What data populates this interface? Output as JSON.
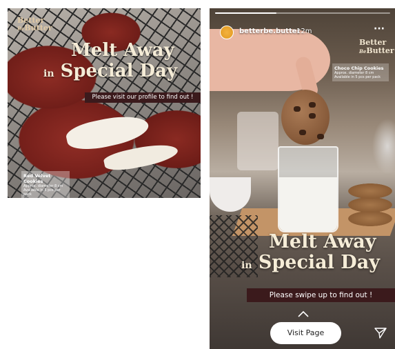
{
  "post": {
    "logo_line1": "Better",
    "logo_be": "Be",
    "logo_line2": "Butter",
    "headline_line1": "Melt Away",
    "headline_in": "in",
    "headline_line2": "Special Day",
    "banner": "Please visit our profile to find out !",
    "caption_title": "Red Velvet Cookies",
    "caption_line1": "Approx. diameter 8 cm",
    "caption_line2": "Available in 5 pcs per pack"
  },
  "story": {
    "progress_fraction": 0.35,
    "username": "betterbe.butter",
    "time": "12m",
    "more_icon": "more-options-icon",
    "logo_line1": "Better",
    "logo_be": "Be",
    "logo_line2": "Butter",
    "caption_title": "Choco Chip Cookies",
    "caption_line1": "Approx. diameter 8 cm",
    "caption_line2": "Available in 5 pcs per pack",
    "headline_line1": "Melt Away",
    "headline_in": "in",
    "headline_line2": "Special Day",
    "banner": "Please swipe up to find out !",
    "visit_label": "Visit Page",
    "send_icon": "send-icon"
  },
  "colors": {
    "banner_bg": "#3b1a1c",
    "headline_text": "#f5ecd7",
    "avatar_orange": "#f3b23f"
  }
}
